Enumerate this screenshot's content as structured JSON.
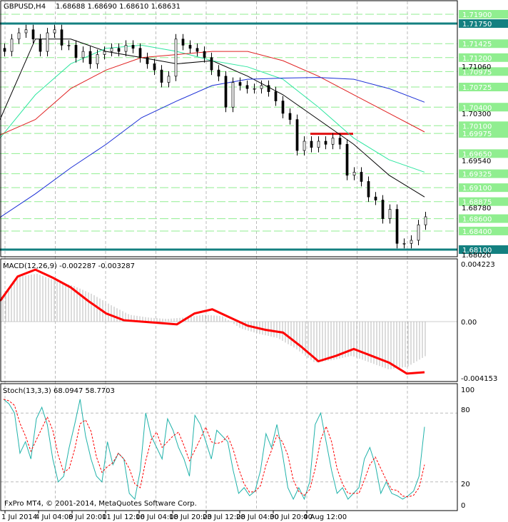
{
  "header": {
    "symbol": "GBPUSD,H4",
    "ohlc": "1.68688 1.68690 1.68610 1.68631"
  },
  "macd": {
    "label": "MACD(12,26,9) -0.002287 -0.003287",
    "axis": [
      "0.004223",
      "0.00",
      "-0.004153"
    ]
  },
  "stoch": {
    "label": "Stoch(13,3,3) 68.0947 58.7703",
    "axis": [
      "100",
      "80",
      "20",
      "0"
    ]
  },
  "copyright": "FxPro MT4, © 2001-2014, MetaQuotes Software Corp.",
  "colors": {
    "candle": "#000000",
    "ma_fast": "#000000",
    "ma_green": "#2ee6a0",
    "ma_red": "#e02020",
    "ma_blue": "#1a2ed6",
    "level": "#90ee90",
    "key_level": "#138080",
    "resistance": "#e01010",
    "signal": "#ff0000",
    "stoch_main": "#20b2aa"
  },
  "chart_data": {
    "type": "line",
    "title": "GBPUSD,H4",
    "price_axis": {
      "ylim": [
        1.6802,
        1.7205
      ],
      "black_labels": [
        "1.71060",
        "1.70300",
        "1.69540",
        "1.68780",
        "1.68020"
      ]
    },
    "levels": [
      {
        "label": "1.71900",
        "value": 1.719,
        "key": false
      },
      {
        "label": "1.71750",
        "value": 1.7175,
        "key": true
      },
      {
        "label": "1.71425",
        "value": 1.71425,
        "key": false
      },
      {
        "label": "1.71200",
        "value": 1.712,
        "key": false
      },
      {
        "label": "1.70975",
        "value": 1.70975,
        "key": false
      },
      {
        "label": "1.70725",
        "value": 1.70725,
        "key": false
      },
      {
        "label": "1.70400",
        "value": 1.704,
        "key": false
      },
      {
        "label": "1.70100",
        "value": 1.701,
        "key": false
      },
      {
        "label": "1.69975",
        "value": 1.69975,
        "key": false
      },
      {
        "label": "1.69650",
        "value": 1.6965,
        "key": false
      },
      {
        "label": "1.69325",
        "value": 1.69325,
        "key": false
      },
      {
        "label": "1.69100",
        "value": 1.691,
        "key": false
      },
      {
        "label": "1.68875",
        "value": 1.68875,
        "key": false
      },
      {
        "label": "1.68600",
        "value": 1.686,
        "key": false
      },
      {
        "label": "1.68400",
        "value": 1.684,
        "key": false
      },
      {
        "label": "1.68100",
        "value": 1.681,
        "key": true
      }
    ],
    "resistance": {
      "value": 1.6997,
      "from": 43,
      "to": 49
    },
    "time_labels": [
      "1 Jul 2014",
      "4 Jul 04:00",
      "8 Jul 20:00",
      "11 Jul 12:00",
      "16 Jul 04:00",
      "18 Jul 20:00",
      "23 Jul 12:00",
      "28 Jul 04:00",
      "30 Jul 20:00",
      "4 Aug 12:00"
    ],
    "closes": [
      1.713,
      1.715,
      1.716,
      1.7165,
      1.715,
      1.713,
      1.716,
      1.7165,
      1.714,
      1.714,
      1.712,
      1.713,
      1.711,
      1.7125,
      1.713,
      1.7135,
      1.713,
      1.714,
      1.7135,
      1.712,
      1.711,
      1.71,
      1.708,
      1.709,
      1.715,
      1.714,
      1.7135,
      1.713,
      1.712,
      1.71,
      1.709,
      1.704,
      1.708,
      1.7075,
      1.707,
      1.707,
      1.7075,
      1.7065,
      1.705,
      1.703,
      1.702,
      1.697,
      1.6985,
      1.6975,
      1.6985,
      1.698,
      1.699,
      1.698,
      1.693,
      1.6935,
      1.692,
      1.6895,
      1.689,
      1.686,
      1.6875,
      1.682,
      1.682,
      1.6825,
      1.685,
      1.6863
    ],
    "ma": [
      {
        "name": "fast",
        "color": "#000000",
        "values": [
          1.702,
          1.715,
          1.715,
          1.713,
          1.712,
          1.711,
          1.7115,
          1.709,
          1.706,
          1.702,
          1.698,
          1.693,
          1.6895
        ]
      },
      {
        "name": "green",
        "color": "#2ee6a0",
        "values": [
          1.699,
          1.706,
          1.711,
          1.7135,
          1.714,
          1.713,
          1.7115,
          1.7105,
          1.7085,
          1.704,
          1.699,
          1.6955,
          1.6935
        ]
      },
      {
        "name": "red",
        "color": "#e02020",
        "values": [
          1.6995,
          1.702,
          1.707,
          1.71,
          1.712,
          1.7125,
          1.713,
          1.713,
          1.7115,
          1.709,
          1.706,
          1.703,
          1.7
        ]
      },
      {
        "name": "blue",
        "color": "#1a2ed6",
        "values": [
          1.6862,
          1.69,
          1.6942,
          1.698,
          1.7023,
          1.705,
          1.7075,
          1.7085,
          1.7087,
          1.7088,
          1.7085,
          1.707,
          1.7048
        ]
      }
    ],
    "macd_hist": [
      0.0015,
      0.0033,
      0.0035,
      0.003,
      0.0026,
      0.002,
      0.0012,
      0.0005,
      0.0003,
      0.0002,
      0.0003,
      0.0005,
      0.0004,
      -0.0005,
      -0.0009,
      -0.0012,
      -0.002,
      -0.003,
      -0.0028,
      -0.0025,
      -0.003,
      -0.0035,
      -0.0033,
      -0.0025
    ],
    "macd_signal": [
      0.0015,
      0.0033,
      0.0038,
      0.0032,
      0.0025,
      0.0015,
      0.0006,
      0.0001,
      0.0,
      -0.0001,
      -0.0002,
      0.0006,
      0.0009,
      0.0003,
      -0.0003,
      -0.0006,
      -0.0008,
      -0.0018,
      -0.0029,
      -0.0025,
      -0.002,
      -0.0025,
      -0.003,
      -0.0038,
      -0.0037
    ],
    "stoch_main": [
      92,
      88,
      80,
      45,
      55,
      40,
      75,
      85,
      70,
      40,
      20,
      25,
      50,
      70,
      92,
      60,
      40,
      25,
      20,
      55,
      35,
      45,
      40,
      10,
      5,
      30,
      80,
      60,
      50,
      40,
      75,
      65,
      50,
      40,
      25,
      78,
      70,
      55,
      40,
      65,
      60,
      55,
      30,
      10,
      15,
      8,
      12,
      30,
      62,
      50,
      70,
      45,
      15,
      5,
      15,
      5,
      20,
      70,
      80,
      55,
      30,
      10,
      15,
      5,
      10,
      15,
      40,
      50,
      35,
      10,
      20,
      10,
      8,
      5,
      8,
      12,
      25,
      68
    ]
  }
}
